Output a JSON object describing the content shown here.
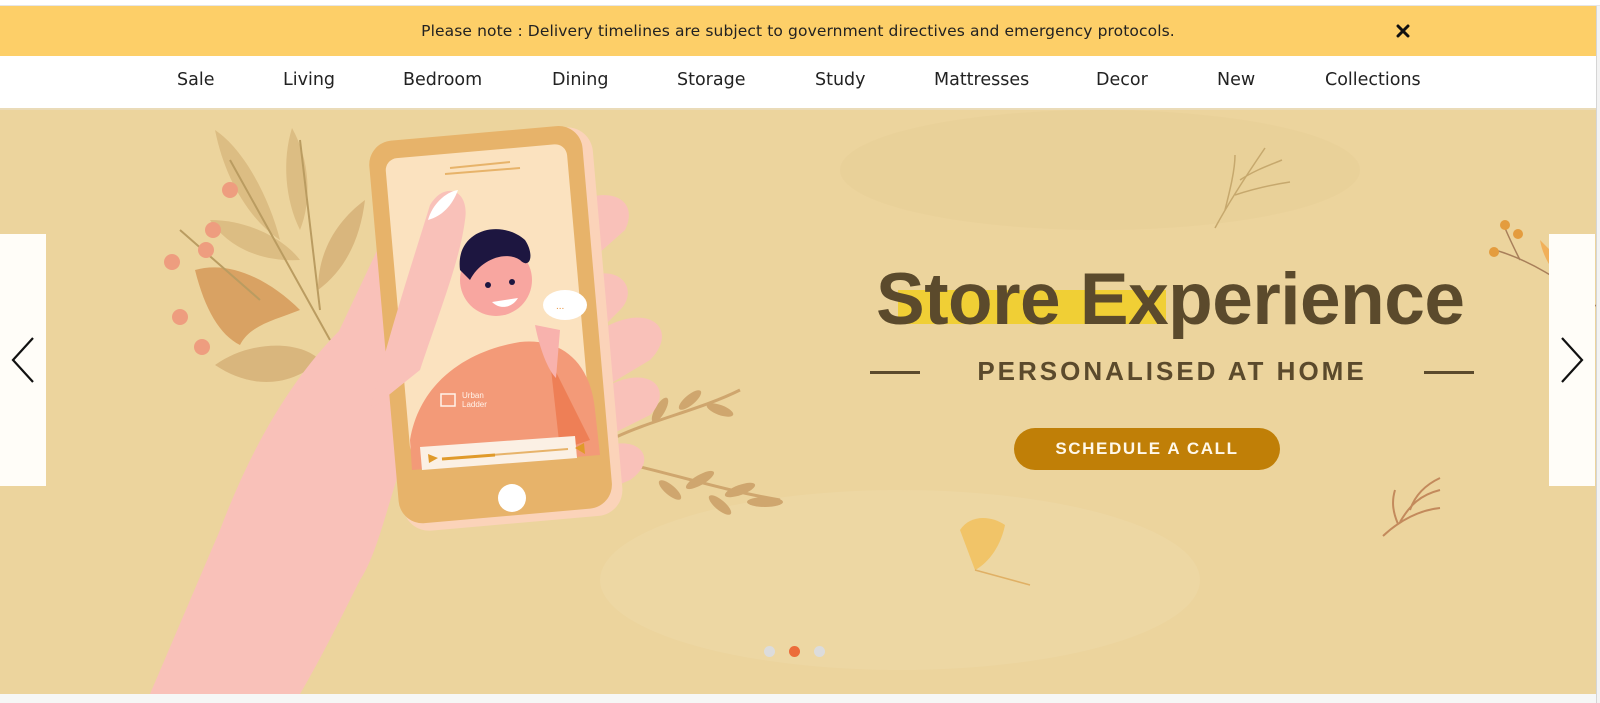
{
  "notice": {
    "text": "Please note : Delivery timelines are subject to government directives and emergency protocols.",
    "close_icon": "close-icon"
  },
  "nav": {
    "items": [
      {
        "label": "Sale"
      },
      {
        "label": "Living"
      },
      {
        "label": "Bedroom"
      },
      {
        "label": "Dining"
      },
      {
        "label": "Storage"
      },
      {
        "label": "Study"
      },
      {
        "label": "Mattresses"
      },
      {
        "label": "Decor"
      },
      {
        "label": "New"
      },
      {
        "label": "Collections"
      }
    ]
  },
  "hero": {
    "headline": "Store Experience",
    "subheadline": "PERSONALISED AT HOME",
    "cta_label": "SCHEDULE A CALL",
    "phone_brand": [
      "Urban",
      "Ladder"
    ],
    "speech_bubble": "...",
    "prev_icon": "chevron-left-icon",
    "next_icon": "chevron-right-icon",
    "carousel": {
      "total_slides": 3,
      "active_slide": 2
    }
  },
  "colors": {
    "notice_bg": "#fdcf68",
    "hero_bg": "#ecd49d",
    "headline": "#5b4a2c",
    "highlight": "#f0cf35",
    "cta_bg": "#c07f07",
    "dot_active": "#ec6c3a",
    "dot_inactive": "#dcdcdc"
  }
}
